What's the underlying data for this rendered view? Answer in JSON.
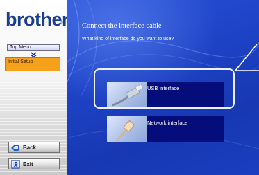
{
  "sidebar": {
    "logo": "brother",
    "logo_mark": "®",
    "nav_top": "Top Menu",
    "nav_current": "Initial Setup",
    "back_label": "Back",
    "exit_label": "Exit"
  },
  "main": {
    "title": "Connect the interface cable",
    "subtitle": "What kind of interface do you want to use?",
    "options": [
      {
        "label": "USB interface",
        "selected": true
      },
      {
        "label": "Network interface",
        "selected": false
      }
    ]
  },
  "colors": {
    "brand": "#1b3f8f",
    "panel_blue": "#1f44c8",
    "option_bg": "#050d7a",
    "current_step": "#f6a11b",
    "back_icon": "#1b5fd6"
  },
  "icons": {
    "nav_arrow": "chevron-down-icon",
    "back": "back-arrow-icon",
    "exit": "exit-door-icon",
    "usb": "usb-cable-icon",
    "network": "network-cable-icon"
  }
}
